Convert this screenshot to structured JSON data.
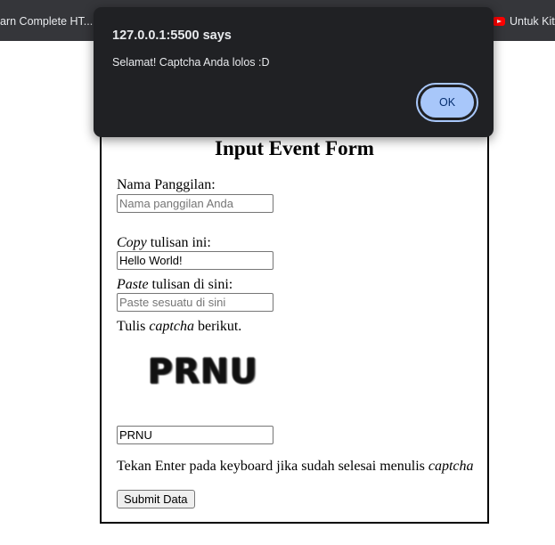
{
  "browser": {
    "bookmark_left": "arn Complete HT...",
    "bookmark_right": "Untuk Kit"
  },
  "dialog": {
    "title": "127.0.0.1:5500 says",
    "message": "Selamat! Captcha Anda lolos :D",
    "ok_label": "OK"
  },
  "form": {
    "title": "Input Event Form",
    "nickname_label": "Nama Panggilan:",
    "nickname_placeholder": "Nama panggilan Anda",
    "nickname_value": "",
    "copy_label_em": "Copy",
    "copy_label_rest": " tulisan ini:",
    "copy_value": "Hello World!",
    "paste_label_em": "Paste",
    "paste_label_rest": " tulisan di sini:",
    "paste_placeholder": "Paste sesuatu di sini",
    "paste_value": "",
    "captcha_label_pre": "Tulis ",
    "captcha_label_em": "captcha",
    "captcha_label_post": " berikut.",
    "captcha_image_text": "PRNU",
    "captcha_input_value": "PRNU",
    "hint_pre": "Tekan Enter pada keyboard jika sudah selesai menulis ",
    "hint_em": "captcha",
    "submit_label": "Submit Data"
  }
}
